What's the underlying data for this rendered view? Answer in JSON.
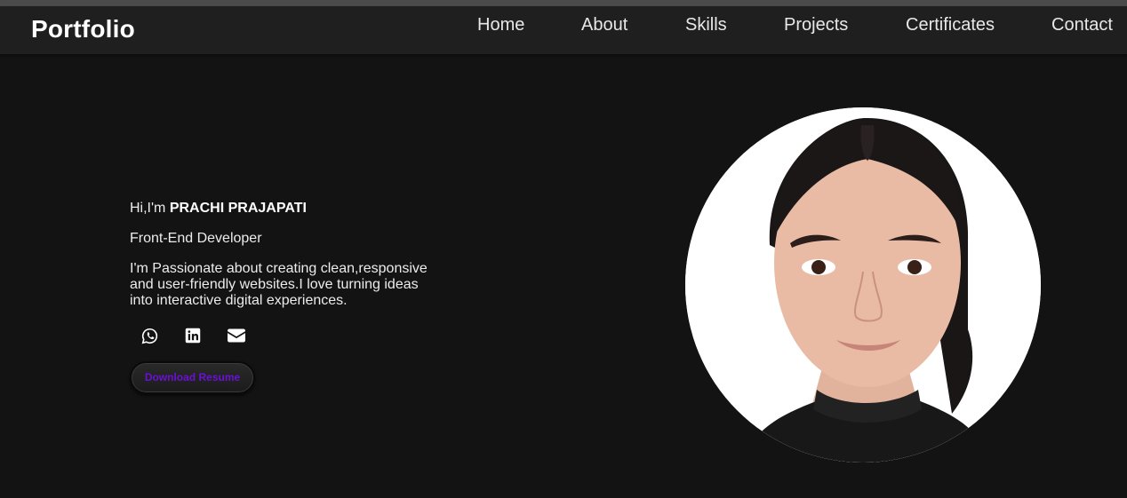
{
  "header": {
    "brand": "Portfolio",
    "nav": [
      "Home",
      "About",
      "Skills",
      "Projects",
      "Certificates",
      "Contact"
    ]
  },
  "hero": {
    "greeting_prefix": "Hi,I'm ",
    "name": "PRACHI PRAJAPATI",
    "role": "Front-End Developer",
    "bio": "I'm Passionate about creating clean,responsive and user-friendly websites.I love turning ideas into interactive digital experiences.",
    "socials": [
      "whatsapp-icon",
      "linkedin-icon",
      "email-icon"
    ],
    "resume_label": "Download Resume"
  },
  "colors": {
    "background": "#131313",
    "navbar": "#1f1f1f",
    "accent": "#6b10d6"
  }
}
